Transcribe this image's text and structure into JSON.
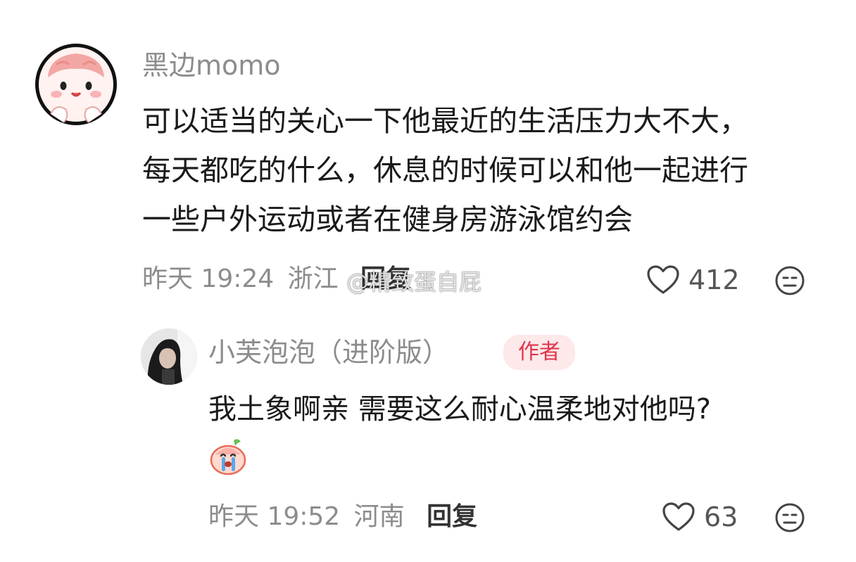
{
  "comment_main": {
    "username": "黑边momo",
    "lines": [
      "可以适当的关心一下他最近的生活压力大不大，",
      "每天都吃的什么，休息的时候可以和他一起进行",
      "一些户外运动或者在健身房游泳馆约会"
    ],
    "time": "昨天 19:24",
    "location": "浙江",
    "reply_label": "回复",
    "likes": "412",
    "avatar_icon": "pink-bun-avatar-icon"
  },
  "watermark": {
    "text": "@精致蛋自屁"
  },
  "comment_reply": {
    "username": "小芙泡泡（进阶版）",
    "badge": "作者",
    "text": "我土象啊亲  需要这么耐心温柔地对他吗?",
    "time": "昨天 19:52",
    "location": "河南",
    "reply_label": "回复",
    "likes": "63",
    "sticker_icon": "crying-peach-sticker-icon",
    "avatar_icon": "photo-avatar-icon"
  },
  "colors": {
    "meta_gray": "#8c8c8c",
    "badge_bg": "#fde8ea",
    "badge_text": "#e0344b"
  }
}
